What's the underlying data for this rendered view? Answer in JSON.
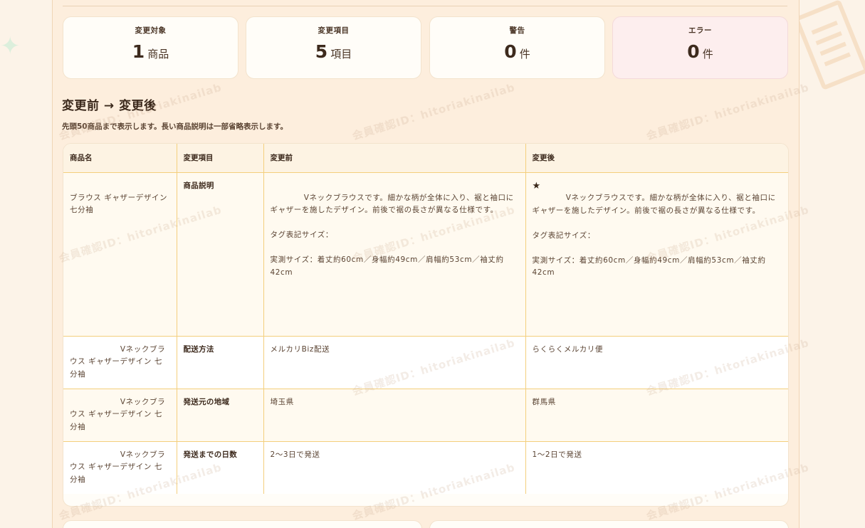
{
  "summary": [
    {
      "label": "変更対象",
      "value": "1",
      "unit": "商品",
      "tone": "normal"
    },
    {
      "label": "変更項目",
      "value": "5",
      "unit": "項目",
      "tone": "normal"
    },
    {
      "label": "警告",
      "value": "0",
      "unit": "件",
      "tone": "normal"
    },
    {
      "label": "エラー",
      "value": "0",
      "unit": "件",
      "tone": "error"
    }
  ],
  "section": {
    "title": "変更前 → 変更後",
    "note": "先頭50商品まで表示します。長い商品説明は一部省略表示します。"
  },
  "table": {
    "headers": [
      "商品名",
      "変更項目",
      "変更前",
      "変更後"
    ],
    "rows": [
      {
        "product": "ブラウス ギャザーデザイン 七分袖",
        "item": "商品説明",
        "before": "            Vネックブラウスです。細かな柄が全体に入り、裾と袖口にギャザーを施したデザイン。前後で裾の長さが異なる仕様です。\n\nタグ表記サイズ：\n\n実測サイズ：着丈約60cm／身幅約49cm／肩幅約53cm／袖丈約42cm",
        "after_mark": "★",
        "after": "            Vネックブラウスです。細かな柄が全体に入り、裾と袖口にギャザーを施したデザイン。前後で裾の長さが異なる仕様です。\n\nタグ表記サイズ：\n\n実測サイズ：着丈約60cm／身幅約49cm／肩幅約53cm／袖丈約42cm"
      },
      {
        "product": "                  Vネックブラウス ギャザーデザイン 七分袖",
        "item": "配送方法",
        "before": "メルカリBiz配送",
        "after": "らくらくメルカリ便"
      },
      {
        "product": "                  Vネックブラウス ギャザーデザイン 七分袖",
        "item": "発送元の地域",
        "before": "埼玉県",
        "after": "群馬県"
      },
      {
        "product": "                  Vネックブラウス ギャザーデザイン 七分袖",
        "item": "発送までの日数",
        "before": "2〜3日で発送",
        "after": "1〜2日で発送"
      }
    ]
  },
  "watermark": "会員確認ID：hitoriakinailab"
}
